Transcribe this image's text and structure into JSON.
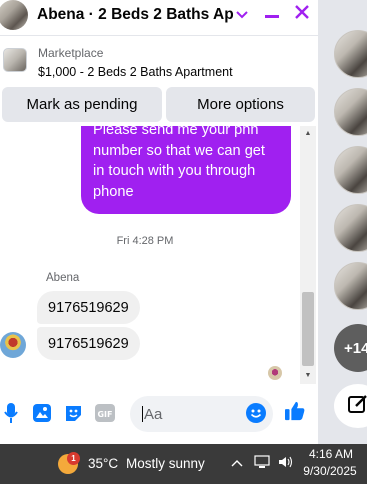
{
  "chat": {
    "title": "Abena · 2 Beds 2 Baths Ap...",
    "marketplace_label": "Marketplace",
    "listing_text": "$1,000 - 2 Beds 2 Baths Apartment",
    "actions": {
      "pending_label": "Mark as pending",
      "options_label": "More options"
    },
    "messages": {
      "sent_text": "Please send me your phn number so that we can get in touch with you through phone",
      "timestamp": "Fri 4:28 PM",
      "sender_name": "Abena",
      "received": [
        "9176519629",
        "9176519629"
      ]
    },
    "composer": {
      "placeholder": "Aa"
    }
  },
  "rail": {
    "more_count": "+14"
  },
  "taskbar": {
    "temperature": "35°C",
    "condition": "Mostly sunny",
    "weather_badge": "1",
    "time": "4:16 AM",
    "date": "9/30/2025"
  },
  "colors": {
    "accent": "#a020f0",
    "messenger_blue": "#0a7cff",
    "taskbar_bg": "#3a3a3a"
  },
  "icons": {
    "header": [
      "chevron-down-icon",
      "minimize-icon",
      "close-icon"
    ],
    "composer": [
      "microphone-icon",
      "image-icon",
      "sticker-icon",
      "gif-icon",
      "emoji-icon",
      "thumbs-up-icon"
    ],
    "tray": [
      "chevron-up-icon",
      "network-icon",
      "volume-icon"
    ]
  }
}
